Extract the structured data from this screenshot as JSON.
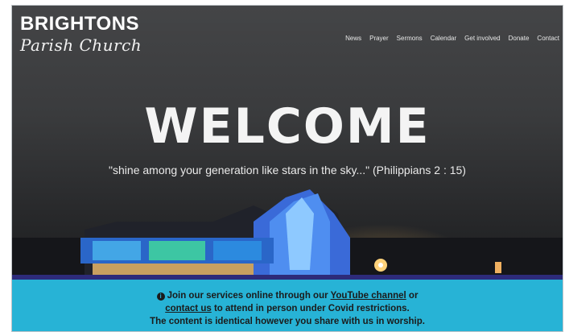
{
  "brand": {
    "line1": "BRIGHTONS",
    "line2": "Parish Church"
  },
  "nav": {
    "items": [
      {
        "label": "News"
      },
      {
        "label": "Prayer"
      },
      {
        "label": "Sermons"
      },
      {
        "label": "Calendar"
      },
      {
        "label": "Get involved"
      },
      {
        "label": "Donate"
      },
      {
        "label": "Contact"
      }
    ]
  },
  "hero": {
    "title": "WELCOME",
    "verse": "\"shine among your generation like stars in the sky...\" (Philippians 2 : 15)"
  },
  "banner": {
    "icon": "info-icon",
    "text1": "Join our services online through our",
    "link1": "YouTube channel",
    "text2": "or",
    "link2": "contact us",
    "text3": "to attend in person under Covid restrictions.",
    "line3": "The content is identical however you share with us in worship."
  },
  "colors": {
    "banner_bg": "#27b3d6",
    "banner_border": "#2d2b7a",
    "hero_bg": "#3a3b3d"
  }
}
